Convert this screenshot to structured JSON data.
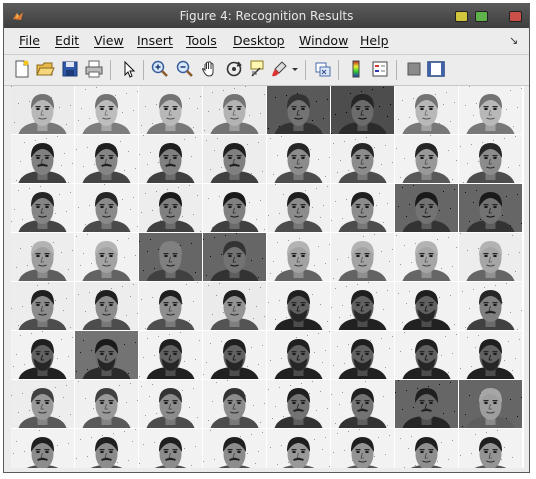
{
  "window": {
    "title": "Figure 4: Recognition Results",
    "controls": [
      "minimize",
      "maximize",
      "close"
    ]
  },
  "menu": [
    {
      "id": "file",
      "label": "File"
    },
    {
      "id": "edit",
      "label": "Edit"
    },
    {
      "id": "view",
      "label": "View"
    },
    {
      "id": "insert",
      "label": "Insert"
    },
    {
      "id": "tools",
      "label": "Tools"
    },
    {
      "id": "desktop",
      "label": "Desktop"
    },
    {
      "id": "window",
      "label": "Window"
    },
    {
      "id": "help",
      "label": "Help"
    }
  ],
  "toolbar": [
    "new-figure-icon",
    "open-file-icon",
    "save-icon",
    "print-icon",
    "pointer-icon",
    "zoom-in-icon",
    "zoom-out-icon",
    "pan-icon",
    "rotate-3d-icon",
    "data-cursor-icon",
    "brush-icon",
    "brush-dropdown-icon",
    "link-plot-icon",
    "colorbar-icon",
    "legend-icon",
    "hide-plot-tools-icon",
    "show-plot-tools-icon"
  ],
  "colors": {
    "title_bar": "#4a4a4a",
    "window_bg": "#ececec",
    "minimize": "#d1c53d",
    "maximize": "#5fb34a",
    "close": "#c95048"
  },
  "grid": {
    "rows": 8,
    "cols": 8,
    "faces": [
      [
        {
          "s": 0.72,
          "bg": 0.92,
          "h": 0.45,
          "m": 0
        },
        {
          "s": 0.74,
          "bg": 0.94,
          "h": 0.45,
          "m": 0
        },
        {
          "s": 0.72,
          "bg": 0.93,
          "h": 0.45,
          "m": 0
        },
        {
          "s": 0.7,
          "bg": 0.92,
          "h": 0.45,
          "m": 0
        },
        {
          "s": 0.45,
          "bg": 0.35,
          "h": 0.2,
          "m": 0
        },
        {
          "s": 0.42,
          "bg": 0.3,
          "h": 0.15,
          "m": 0
        },
        {
          "s": 0.72,
          "bg": 0.94,
          "h": 0.45,
          "m": 0
        },
        {
          "s": 0.72,
          "bg": 0.95,
          "h": 0.45,
          "m": 0
        }
      ],
      [
        {
          "s": 0.5,
          "bg": 0.95,
          "h": 0.12,
          "m": 1
        },
        {
          "s": 0.52,
          "bg": 0.95,
          "h": 0.12,
          "m": 1
        },
        {
          "s": 0.5,
          "bg": 0.94,
          "h": 0.12,
          "m": 1
        },
        {
          "s": 0.5,
          "bg": 0.93,
          "h": 0.12,
          "m": 1
        },
        {
          "s": 0.55,
          "bg": 0.95,
          "h": 0.15,
          "m": 0
        },
        {
          "s": 0.55,
          "bg": 0.94,
          "h": 0.15,
          "m": 0
        },
        {
          "s": 0.6,
          "bg": 0.95,
          "h": 0.15,
          "m": 0
        },
        {
          "s": 0.55,
          "bg": 0.95,
          "h": 0.15,
          "m": 0
        }
      ],
      [
        {
          "s": 0.52,
          "bg": 0.95,
          "h": 0.15,
          "m": 0
        },
        {
          "s": 0.54,
          "bg": 0.95,
          "h": 0.15,
          "m": 0
        },
        {
          "s": 0.5,
          "bg": 0.93,
          "h": 0.1,
          "m": 0
        },
        {
          "s": 0.5,
          "bg": 0.95,
          "h": 0.1,
          "m": 0
        },
        {
          "s": 0.55,
          "bg": 0.94,
          "h": 0.12,
          "m": 0
        },
        {
          "s": 0.55,
          "bg": 0.95,
          "h": 0.12,
          "m": 0
        },
        {
          "s": 0.45,
          "bg": 0.4,
          "h": 0.1,
          "m": 0
        },
        {
          "s": 0.45,
          "bg": 0.4,
          "h": 0.1,
          "m": 0
        }
      ],
      [
        {
          "s": 0.62,
          "bg": 0.93,
          "h": 0.7,
          "m": 0
        },
        {
          "s": 0.64,
          "bg": 0.95,
          "h": 0.7,
          "m": 0
        },
        {
          "s": 0.5,
          "bg": 0.4,
          "h": 0.5,
          "m": 0
        },
        {
          "s": 0.45,
          "bg": 0.4,
          "h": 0.2,
          "m": 0
        },
        {
          "s": 0.64,
          "bg": 0.95,
          "h": 0.7,
          "m": 0
        },
        {
          "s": 0.64,
          "bg": 0.94,
          "h": 0.7,
          "m": 0
        },
        {
          "s": 0.65,
          "bg": 0.95,
          "h": 0.7,
          "m": 0
        },
        {
          "s": 0.65,
          "bg": 0.93,
          "h": 0.7,
          "m": 0
        }
      ],
      [
        {
          "s": 0.55,
          "bg": 0.93,
          "h": 0.12,
          "m": 0
        },
        {
          "s": 0.55,
          "bg": 0.93,
          "h": 0.12,
          "m": 0
        },
        {
          "s": 0.56,
          "bg": 0.94,
          "h": 0.12,
          "m": 0
        },
        {
          "s": 0.58,
          "bg": 0.92,
          "h": 0.12,
          "m": 0
        },
        {
          "s": 0.38,
          "bg": 0.95,
          "h": 0.12,
          "m": 2
        },
        {
          "s": 0.38,
          "bg": 0.95,
          "h": 0.12,
          "m": 2
        },
        {
          "s": 0.38,
          "bg": 0.95,
          "h": 0.12,
          "m": 2
        },
        {
          "s": 0.5,
          "bg": 0.95,
          "h": 0.15,
          "m": 1
        }
      ],
      [
        {
          "s": 0.38,
          "bg": 0.95,
          "h": 0.12,
          "m": 2
        },
        {
          "s": 0.42,
          "bg": 0.45,
          "h": 0.1,
          "m": 2
        },
        {
          "s": 0.38,
          "bg": 0.95,
          "h": 0.12,
          "m": 2
        },
        {
          "s": 0.38,
          "bg": 0.95,
          "h": 0.12,
          "m": 2
        },
        {
          "s": 0.38,
          "bg": 0.95,
          "h": 0.12,
          "m": 2
        },
        {
          "s": 0.38,
          "bg": 0.95,
          "h": 0.12,
          "m": 2
        },
        {
          "s": 0.38,
          "bg": 0.95,
          "h": 0.12,
          "m": 2
        },
        {
          "s": 0.38,
          "bg": 0.95,
          "h": 0.12,
          "m": 2
        }
      ],
      [
        {
          "s": 0.6,
          "bg": 0.93,
          "h": 0.25,
          "m": 0
        },
        {
          "s": 0.6,
          "bg": 0.94,
          "h": 0.25,
          "m": 0
        },
        {
          "s": 0.55,
          "bg": 0.95,
          "h": 0.2,
          "m": 0
        },
        {
          "s": 0.55,
          "bg": 0.95,
          "h": 0.2,
          "m": 0
        },
        {
          "s": 0.45,
          "bg": 0.95,
          "h": 0.12,
          "m": 1
        },
        {
          "s": 0.45,
          "bg": 0.95,
          "h": 0.12,
          "m": 1
        },
        {
          "s": 0.4,
          "bg": 0.4,
          "h": 0.12,
          "m": 1
        },
        {
          "s": 0.62,
          "bg": 0.4,
          "h": 0.65,
          "m": 0
        }
      ],
      [
        {
          "s": 0.55,
          "bg": 0.95,
          "h": 0.12,
          "m": 1
        },
        {
          "s": 0.55,
          "bg": 0.95,
          "h": 0.12,
          "m": 1
        },
        {
          "s": 0.55,
          "bg": 0.95,
          "h": 0.12,
          "m": 1
        },
        {
          "s": 0.55,
          "bg": 0.95,
          "h": 0.12,
          "m": 1
        },
        {
          "s": 0.6,
          "bg": 0.95,
          "h": 0.12,
          "m": 1
        },
        {
          "s": 0.58,
          "bg": 0.95,
          "h": 0.12,
          "m": 0
        },
        {
          "s": 0.56,
          "bg": 0.95,
          "h": 0.12,
          "m": 0
        },
        {
          "s": 0.58,
          "bg": 0.95,
          "h": 0.12,
          "m": 0
        }
      ]
    ]
  }
}
